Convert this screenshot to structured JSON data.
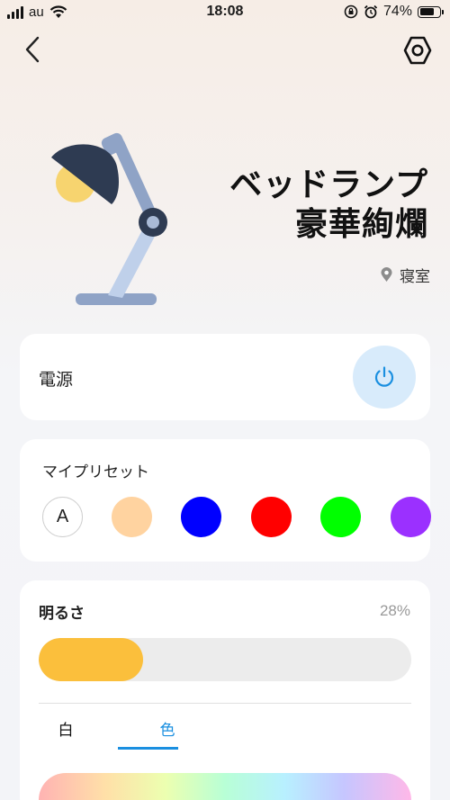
{
  "status_bar": {
    "carrier": "au",
    "time": "18:08",
    "battery_percent": "74%",
    "battery_level": 0.74,
    "icons": [
      "signal-icon",
      "wifi-icon",
      "orientation-lock-icon",
      "alarm-icon",
      "battery-icon"
    ]
  },
  "nav": {
    "back_icon": "chevron-left-icon",
    "settings_icon": "hex-settings-icon"
  },
  "device": {
    "title_line1": "ベッドランプ",
    "title_line2": "豪華絢爛",
    "room": "寝室",
    "room_icon": "location-pin-icon",
    "image": "desk-lamp-illustration"
  },
  "power": {
    "label": "電源",
    "icon": "power-icon",
    "accent": "#1a8fe0"
  },
  "presets": {
    "title": "マイプリセット",
    "auto_label": "A",
    "colors": [
      "#ffd3a0",
      "#0000ff",
      "#ff0000",
      "#00ff00",
      "#9b30ff"
    ]
  },
  "brightness": {
    "label": "明るさ",
    "value_text": "28%",
    "level": 0.28,
    "fill_color": "#fbbf3c"
  },
  "mode_tabs": {
    "white": "白",
    "color": "色",
    "active": "color"
  }
}
